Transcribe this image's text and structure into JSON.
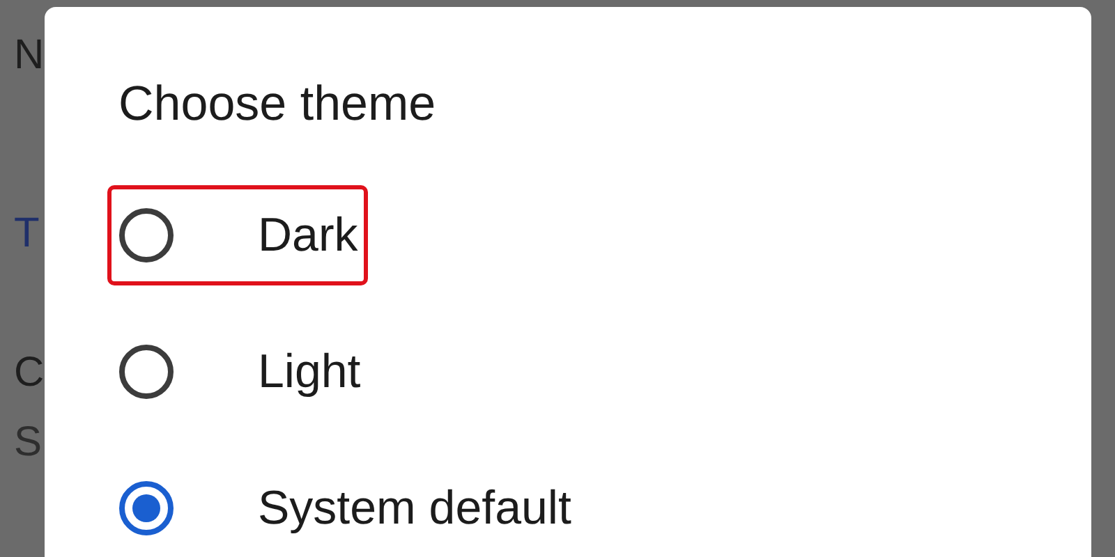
{
  "background_letters": [
    {
      "text": "N",
      "kind": "dark"
    },
    {
      "text": "T",
      "kind": "link"
    },
    {
      "text": "C",
      "kind": "dark"
    },
    {
      "text": "S",
      "kind": "muted"
    }
  ],
  "dialog": {
    "title": "Choose theme",
    "options": [
      {
        "label": "Dark",
        "selected": false,
        "highlighted": true
      },
      {
        "label": "Light",
        "selected": false,
        "highlighted": false
      },
      {
        "label": "System default",
        "selected": true,
        "highlighted": false
      }
    ]
  }
}
